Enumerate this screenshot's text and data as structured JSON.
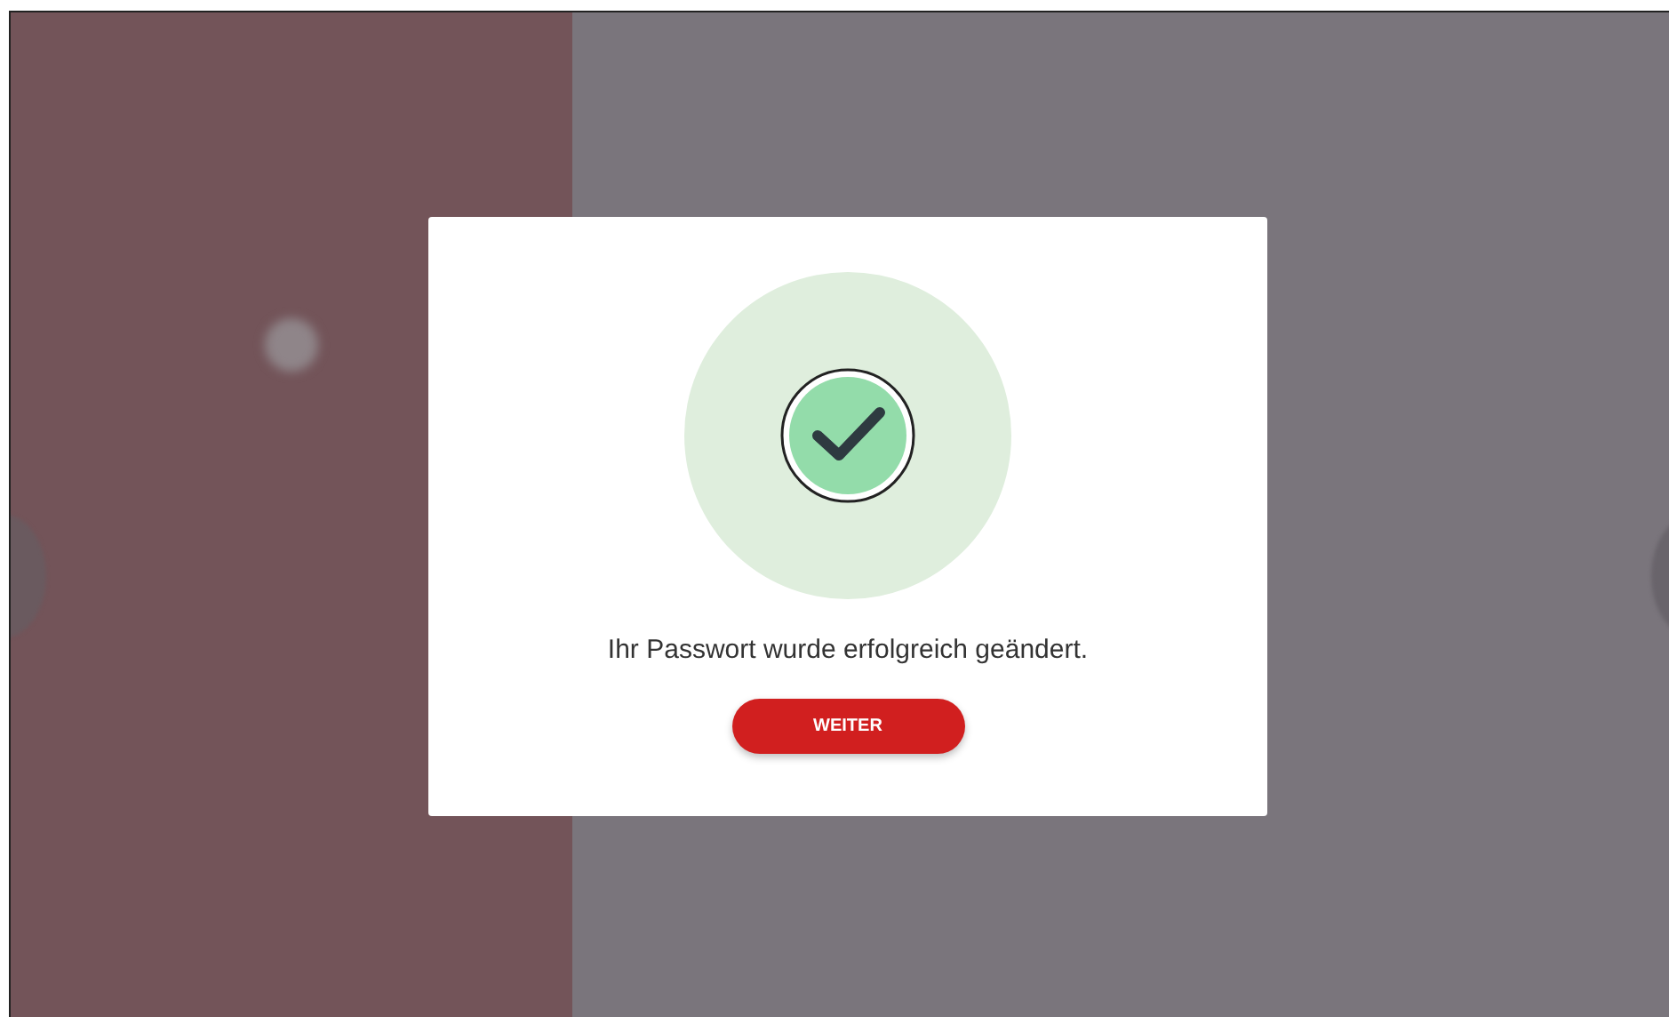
{
  "dialog": {
    "message": "Ihr Passwort wurde erfolgreich geändert.",
    "button": "WEITER"
  }
}
